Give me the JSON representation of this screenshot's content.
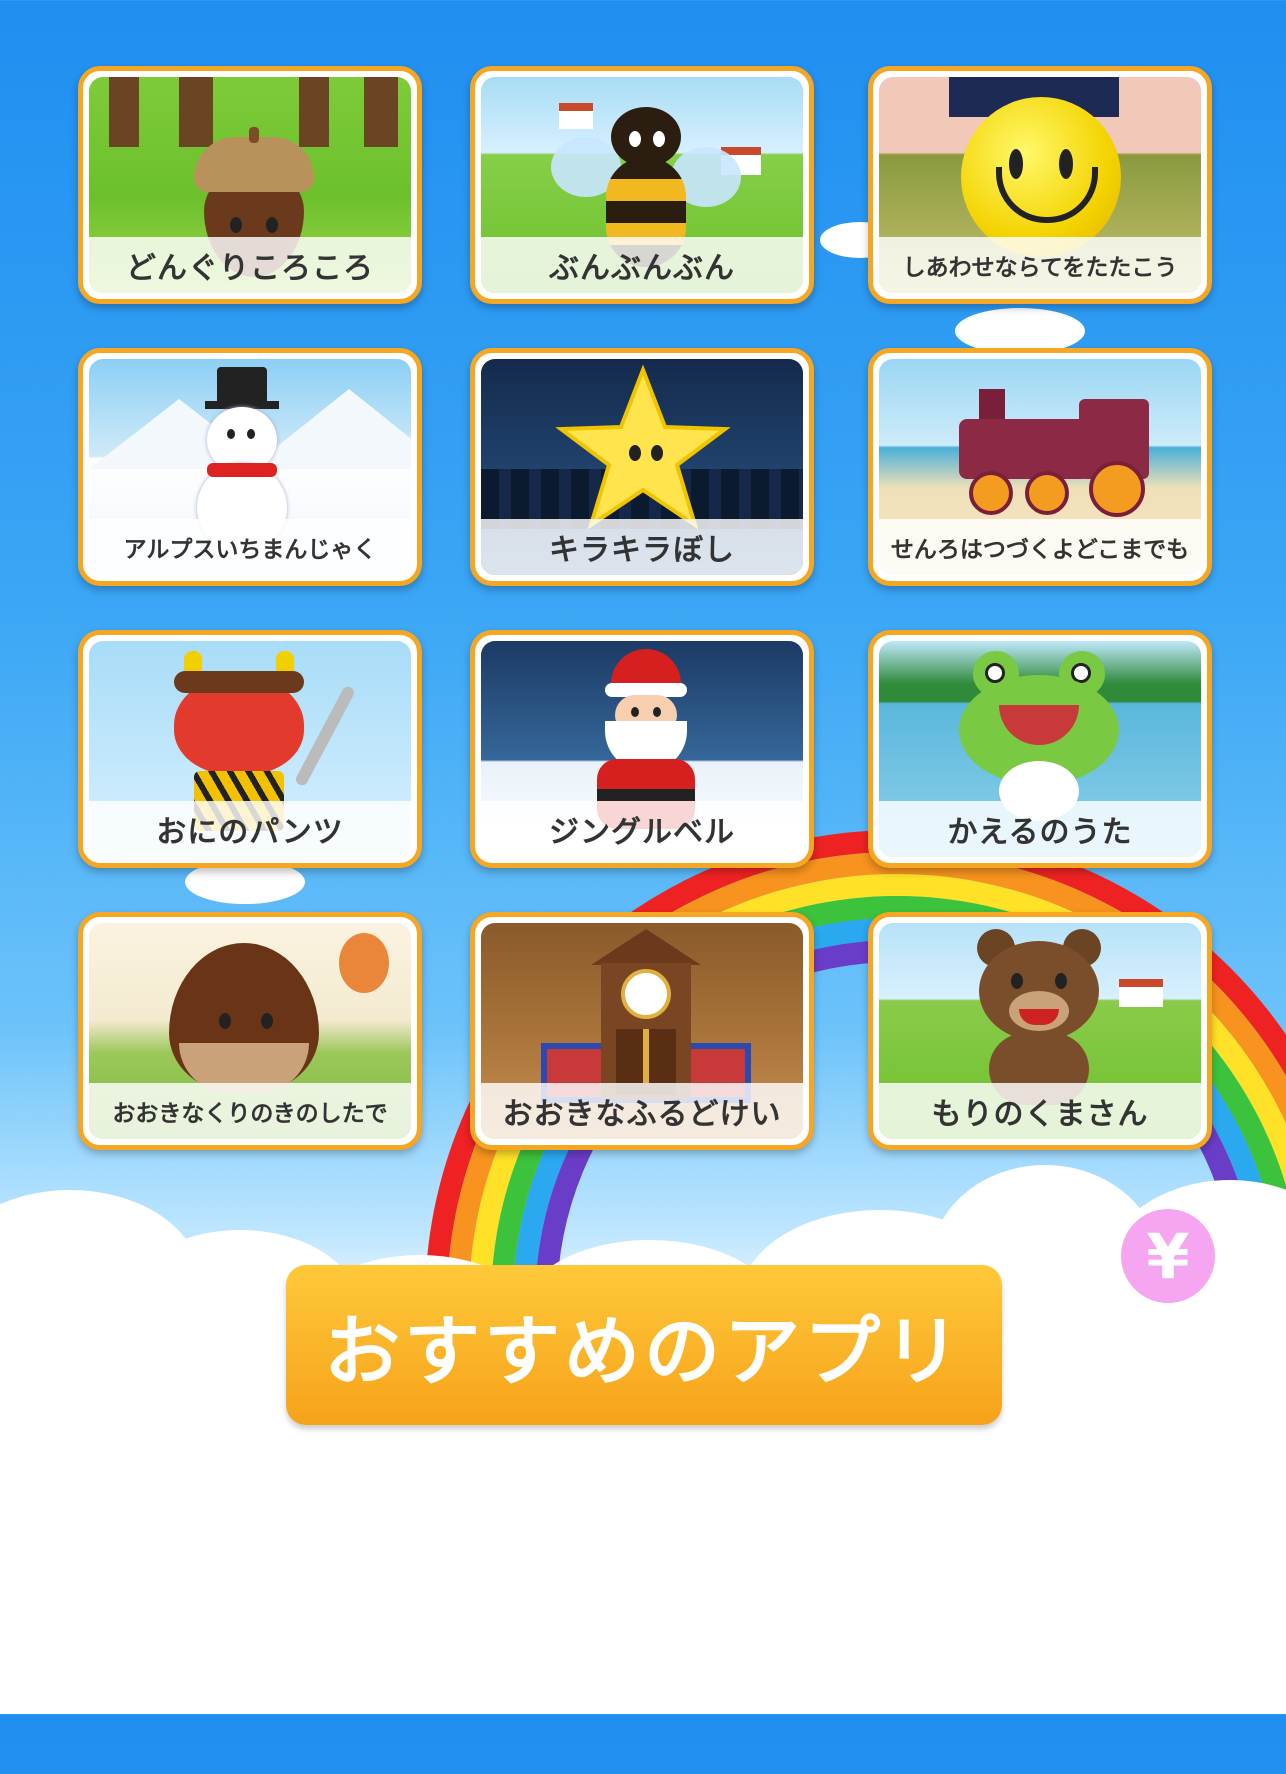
{
  "songs": [
    {
      "label": "どんぐりころころ"
    },
    {
      "label": "ぶんぶんぶん"
    },
    {
      "label": "しあわせならてをたたこう"
    },
    {
      "label": "アルプスいちまんじゃく"
    },
    {
      "label": "キラキラぼし"
    },
    {
      "label": "せんろはつづくよどこまでも"
    },
    {
      "label": "おにのパンツ"
    },
    {
      "label": "ジングルベル"
    },
    {
      "label": "かえるのうた"
    },
    {
      "label": "おおきなくりのきのしたで"
    },
    {
      "label": "おおきなふるどけい"
    },
    {
      "label": "もりのくまさん"
    }
  ],
  "recommend_button": {
    "label": "おすすめのアプリ"
  },
  "yen_button": {
    "label": "¥"
  },
  "colors": {
    "card_border": "#f5a623",
    "button": "#f6a21a",
    "yen": "#f6a5f0",
    "sky": "#2a97f2"
  }
}
